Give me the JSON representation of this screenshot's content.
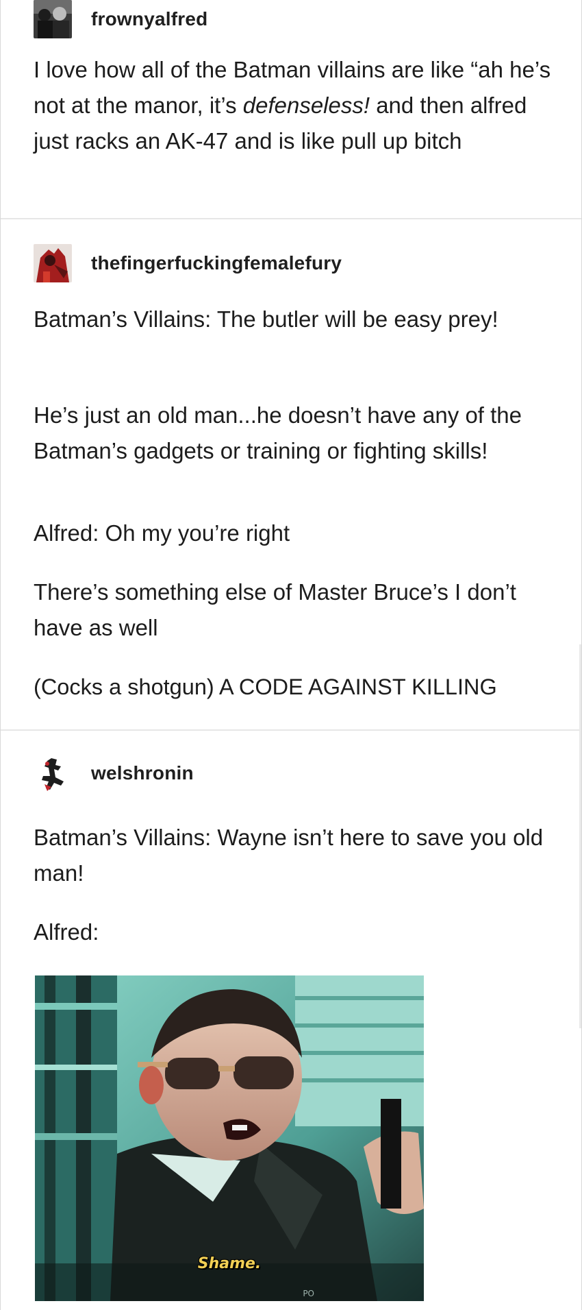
{
  "posts": [
    {
      "username": "frownyalfred",
      "avatar": "avatar-frownyalfred",
      "lines": {
        "p1_before": "I love how all of the Batman villains are like “ah he’s not at the manor, it’s ",
        "p1_italic": "defenseless!",
        "p1_after": " and then alfred just racks an AK-47 and is like pull up bitch"
      }
    },
    {
      "username": "thefingerfuckingfemalefury",
      "avatar": "avatar-thefingerfuckingfemalefury",
      "paragraphs": [
        "Batman’s Villains: The butler will be easy prey!",
        "He’s just an old man...he doesn’t have any of the Batman’s gadgets or training or fighting skills!",
        "Alfred: Oh my you’re right",
        "There’s something else of Master Bruce’s I don’t have as well",
        "(Cocks a shotgun) A CODE AGAINST KILLING"
      ]
    },
    {
      "username": "welshronin",
      "avatar": "avatar-welshronin",
      "paragraphs": [
        "Batman’s Villains: Wayne isn’t here to save you old man!",
        "Alfred:"
      ],
      "gif_caption": "Shame.",
      "gif_watermark": "PO"
    }
  ],
  "colors": {
    "text": "#1c1c1c",
    "divider": "#e6e6e6",
    "gif_caption": "#f2cf54",
    "gif_teal": "#5bb5a8"
  }
}
